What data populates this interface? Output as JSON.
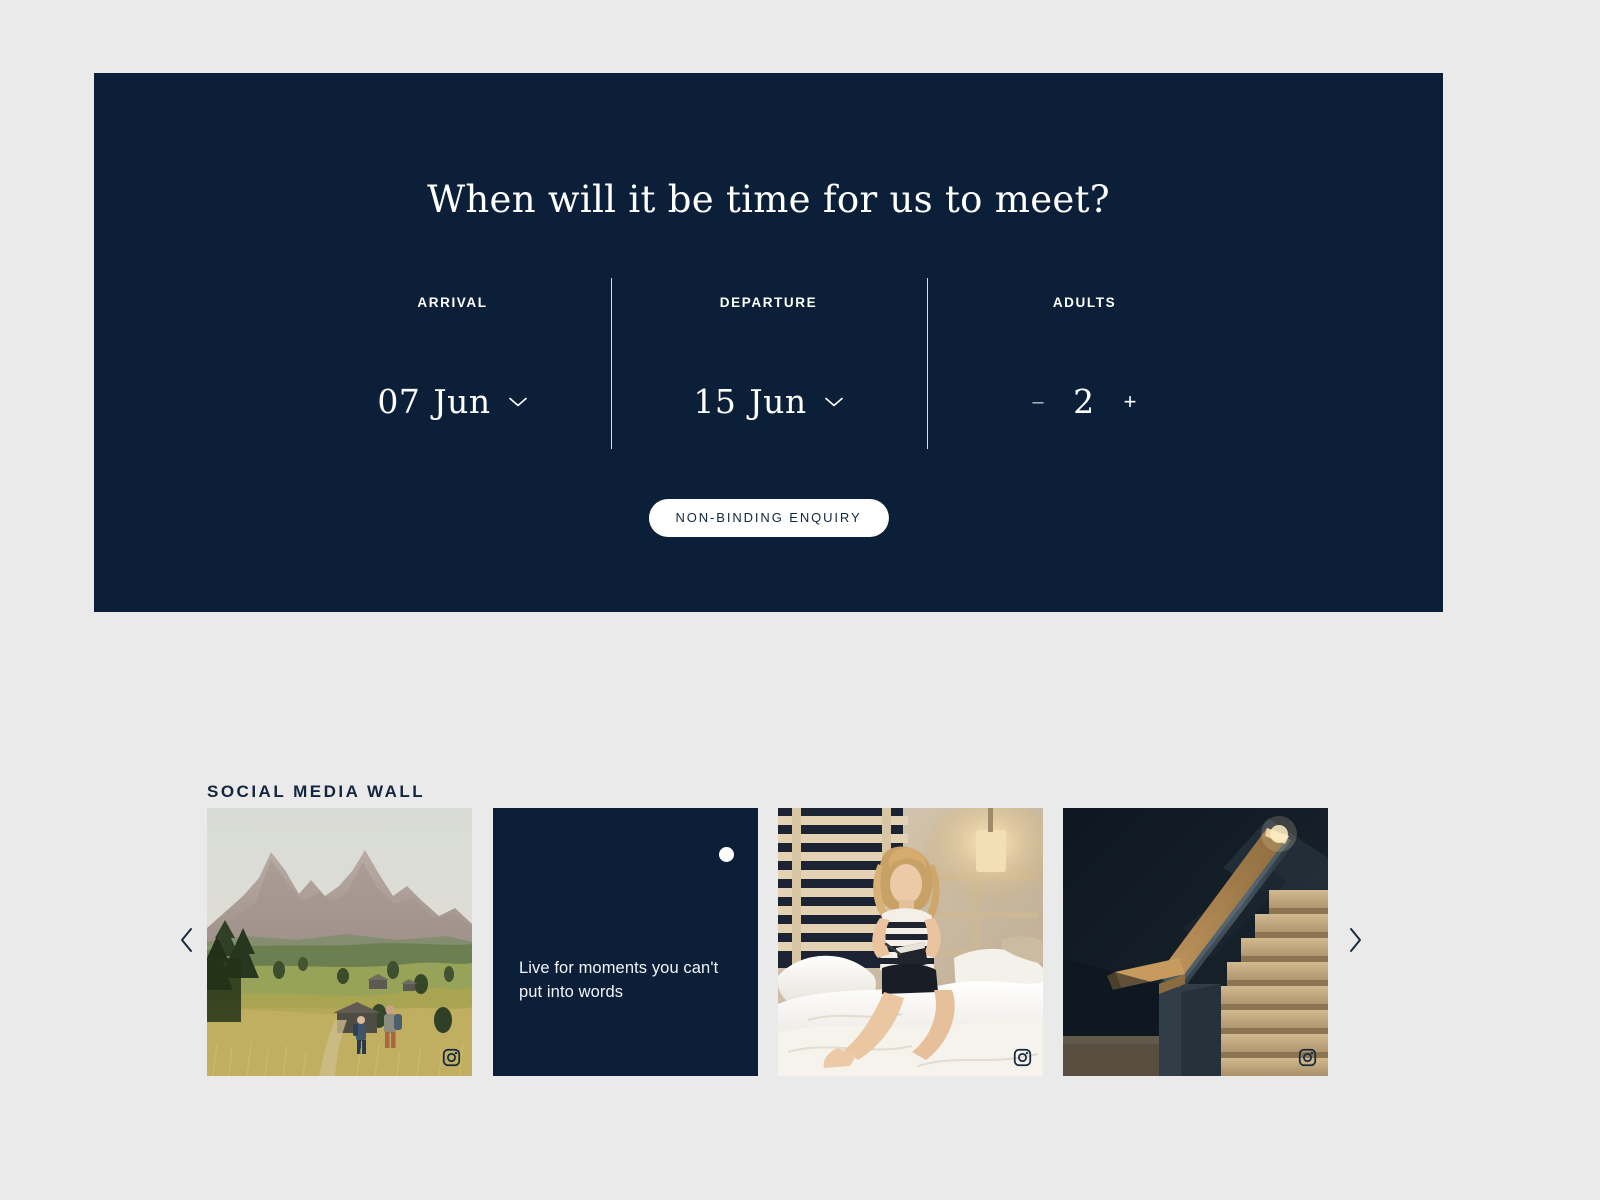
{
  "theme": {
    "navy": "#0b2038",
    "page_background": "#eaeaea",
    "white": "#ffffff",
    "title_navy": "#13263d"
  },
  "booking": {
    "headline": "When will it be time for us to meet?",
    "fields": [
      {
        "label": "ARRIVAL",
        "type": "date",
        "day": "07",
        "month": "Jun",
        "icon": "chevron-down-icon"
      },
      {
        "label": "DEPARTURE",
        "type": "date",
        "day": "15",
        "month": "Jun",
        "icon": "chevron-down-icon"
      },
      {
        "label": "ADULTS",
        "type": "stepper",
        "decrement_label": "–",
        "value": "2",
        "increment_label": "+"
      }
    ],
    "cta_label": "NON-BINDING ENQUIRY"
  },
  "social": {
    "title": "SOCIAL MEDIA WALL",
    "prev_icon": "chevron-left-icon",
    "next_icon": "chevron-right-icon",
    "cards": [
      {
        "kind": "photo",
        "alt": "Alpine meadow with mountain peaks and two hikers walking through a golden grass field",
        "badge_icon": "instagram-icon"
      },
      {
        "kind": "quote",
        "quote": "Live for moments you can't put into words",
        "dot_icon": "dot-mark-icon"
      },
      {
        "kind": "photo",
        "alt": "Woman in striped top sitting on a white bed writing in a notebook beside a warm lamp",
        "badge_icon": "instagram-icon"
      },
      {
        "kind": "photo",
        "alt": "Dark stairwell with illuminated wooden handrail and carpeted steps",
        "badge_icon": "instagram-icon"
      }
    ]
  }
}
